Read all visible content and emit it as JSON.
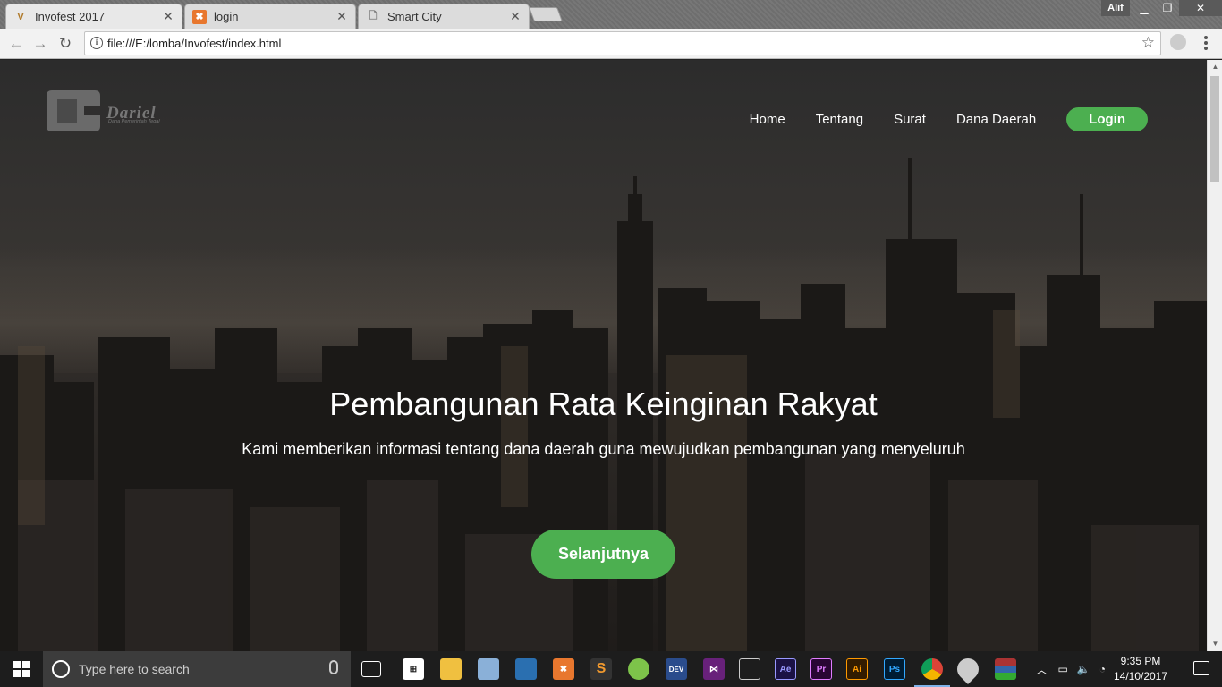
{
  "browser": {
    "tabs": [
      {
        "title": "Invofest 2017",
        "favicon": "v-logo-icon",
        "active": true
      },
      {
        "title": "login",
        "favicon": "xampp-icon",
        "active": false
      },
      {
        "title": "Smart City",
        "favicon": "page-icon",
        "active": false
      }
    ],
    "user_name": "Alif",
    "url": "file:///E:/lomba/Invofest/index.html"
  },
  "site": {
    "logo_text": "Dariel",
    "logo_subtitle": "Dana Pemerintah Tegal",
    "nav": {
      "home": "Home",
      "tentang": "Tentang",
      "surat": "Surat",
      "dana_daerah": "Dana Daerah",
      "login": "Login"
    },
    "hero": {
      "title": "Pembangunan Rata Keinginan Rakyat",
      "subtitle": "Kami memberikan informasi tentang dana daerah guna mewujudkan pembangunan yang menyeluruh",
      "cta": "Selanjutnya"
    },
    "accent_color": "#4caf50"
  },
  "taskbar": {
    "search_placeholder": "Type here to search",
    "time": "9:35 PM",
    "date": "14/10/2017",
    "apps": [
      "task-view-icon",
      "store-icon",
      "file-explorer-icon",
      "virtualbox-icon",
      "virtualbox-blue-icon",
      "xampp-icon",
      "sublime-icon",
      "android-studio-icon",
      "devcpp-icon",
      "visual-studio-icon",
      "movie-maker-icon",
      "after-effects-icon",
      "premiere-icon",
      "illustrator-icon",
      "photoshop-icon",
      "chrome-icon",
      "droplet-icon",
      "winrar-icon"
    ]
  }
}
